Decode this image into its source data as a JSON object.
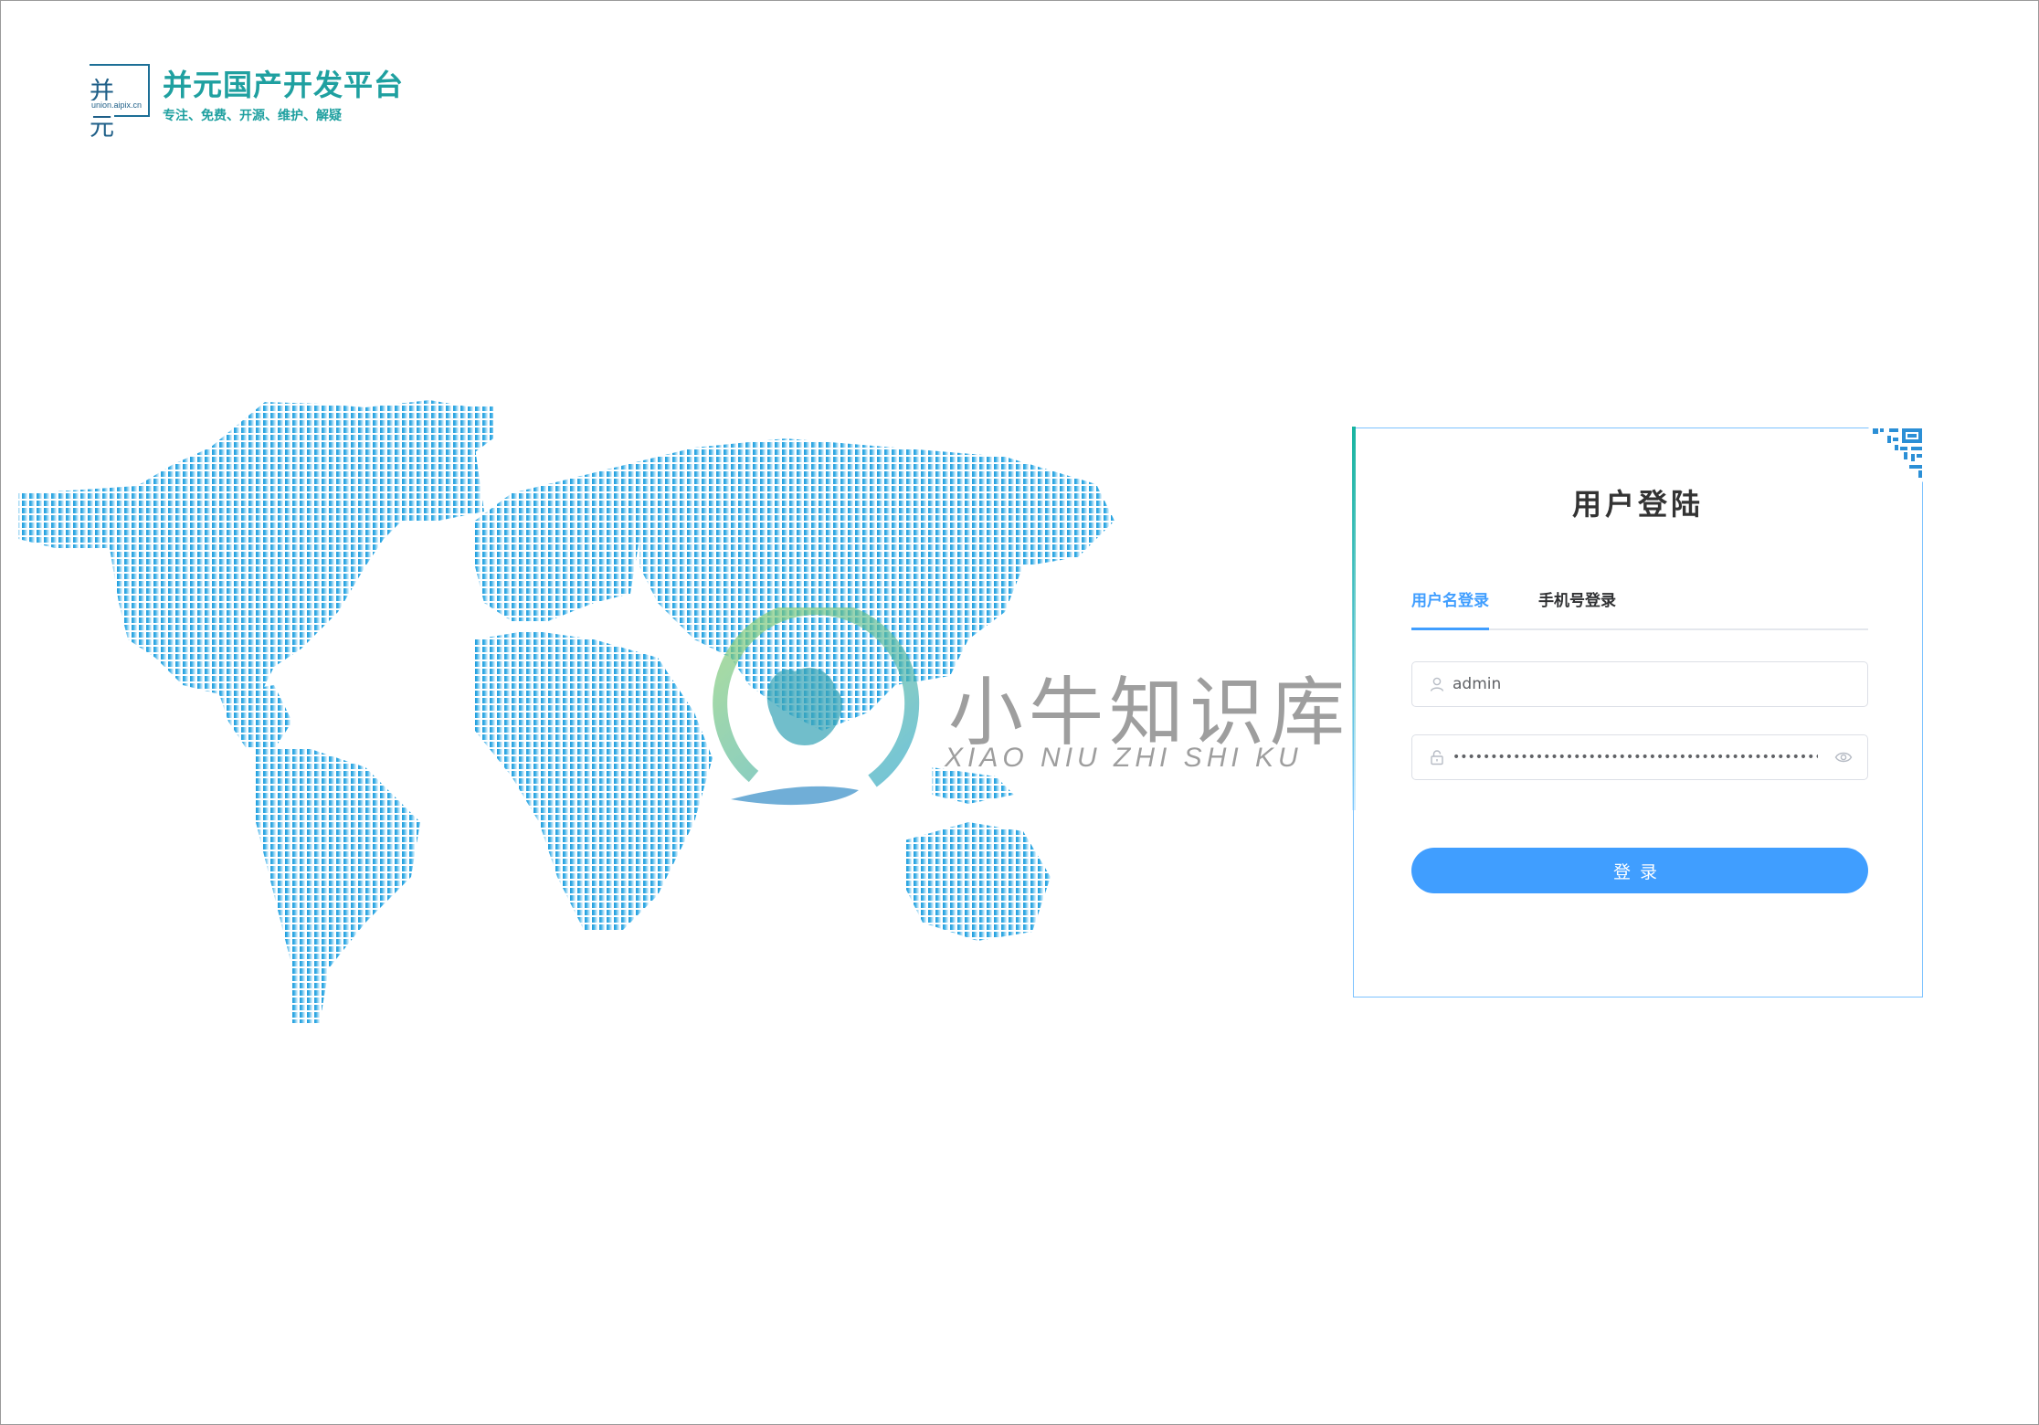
{
  "brand": {
    "logo_chars": "并元",
    "logo_url": "union.aipix.cn",
    "title": "并元国产开发平台",
    "subtitle": "专注、免费、开源、维护、解疑"
  },
  "watermark": {
    "title": "小牛知识库",
    "subtitle": "XIAO NIU ZHI SHI KU"
  },
  "login": {
    "title": "用户登陆",
    "tabs": [
      {
        "label": "用户名登录",
        "active": true
      },
      {
        "label": "手机号登录",
        "active": false
      }
    ],
    "username": {
      "value": "admin",
      "icon": "user-icon"
    },
    "password": {
      "value": "••••••••••••••••••••••••••••••••••••••••••••••••••••••••••••••••••••••••",
      "icon": "lock-icon",
      "toggle_icon": "eye-icon"
    },
    "submit_label": "登录"
  },
  "colors": {
    "brand_teal": "#1fa0a0",
    "accent_blue": "#409eff",
    "map_blue": "#1e9bdc"
  }
}
